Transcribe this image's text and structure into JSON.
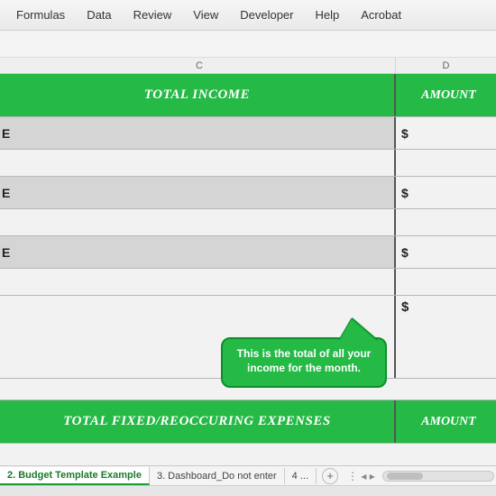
{
  "menu": {
    "items": [
      "Formulas",
      "Data",
      "Review",
      "View",
      "Developer",
      "Help",
      "Acrobat"
    ]
  },
  "columns": {
    "c": "C",
    "d": "D"
  },
  "banner1": {
    "title": "TOTAL INCOME",
    "amount_label": "AMOUNT"
  },
  "rows": {
    "r1_left": "E",
    "r1_d": "$",
    "r2_left": "E",
    "r2_d": "$",
    "r3_left": "E",
    "r3_d": "$",
    "subtotal_d": "$"
  },
  "callout": {
    "text": "This is the total of all your income for the month."
  },
  "banner2": {
    "title": "TOTAL FIXED/REOCCURING EXPENSES",
    "amount_label": "AMOUNT"
  },
  "tabs": {
    "active": "2. Budget Template Example",
    "next": "3. Dashboard_Do not enter",
    "more": "4 ...",
    "plus": "+"
  }
}
